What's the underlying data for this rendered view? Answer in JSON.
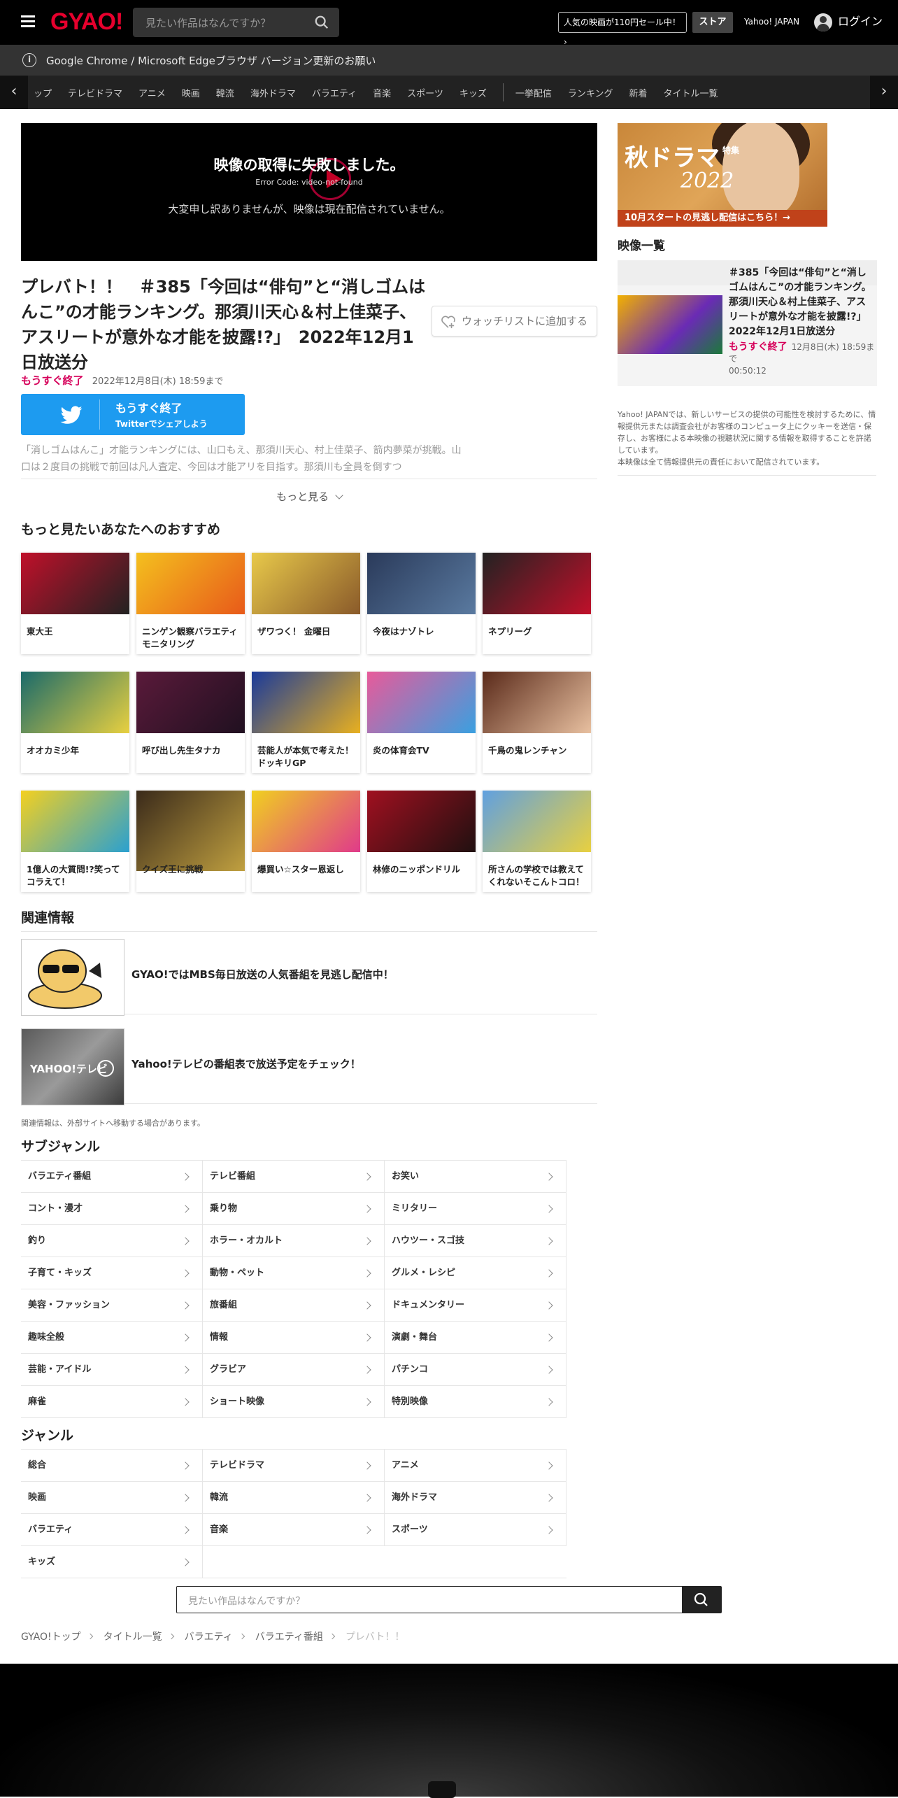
{
  "header": {
    "logo": "GYAO!",
    "search_placeholder": "見たい作品はなんですか？",
    "promo": "人気の映画が110円セール中！",
    "store": "ストア",
    "yahoo": "Yahoo! JAPAN",
    "login": "ログイン"
  },
  "notice": "Google Chrome / Microsoft Edgeブラウザ バージョン更新のお願い",
  "nav": {
    "prev": "‹",
    "next": "›",
    "items": [
      "ップ",
      "テレビドラマ",
      "アニメ",
      "映画",
      "韓流",
      "海外ドラマ",
      "バラエティ",
      "音楽",
      "スポーツ",
      "キッズ"
    ],
    "items2": [
      "一挙配信",
      "ランキング",
      "新着",
      "タイトル一覧"
    ]
  },
  "player": {
    "error_title": "映像の取得に失敗しました。",
    "error_code": "Error Code: video-not-found",
    "message": "大変申し訳ありませんが、映像は現在配信されていません。"
  },
  "episode": {
    "title": "プレバト！！　＃385「今回は“俳句”と“消しゴムはんこ”の才能ランキング。那須川天心＆村上佳菜子、アスリートが意外な才能を披露!?」　2022年12月1日放送分",
    "watchlist": "ウォッチリストに追加する",
    "status": "もうすぐ終了",
    "until": "2022年12月8日(木) 18:59まで",
    "twitter_l1": "もうすぐ終了",
    "twitter_l2": "Twitterでシェアしよう",
    "description": "「消しゴムはんこ」才能ランキングには、山口もえ、那須川天心、村上佳菜子、箭内夢菜が挑戦。山口は２度目の挑戦で前回は凡人査定、今回は才能アリを目指す。那須川も全員を倒すつ",
    "more": "もっと見る"
  },
  "recommend": {
    "heading": "もっと見たいあなたへのおすすめ",
    "items": [
      {
        "title": "東大王"
      },
      {
        "title": "ニンゲン観察バラエティ モニタリング"
      },
      {
        "title": "ザワつく！ 金曜日"
      },
      {
        "title": "今夜はナゾトレ"
      },
      {
        "title": "ネプリーグ"
      },
      {
        "title": "オオカミ少年"
      },
      {
        "title": "呼び出し先生タナカ"
      },
      {
        "title": "芸能人が本気で考えた！ドッキリGP"
      },
      {
        "title": "炎の体育会TV"
      },
      {
        "title": "千鳥の鬼レンチャン"
      },
      {
        "title": "1億人の大質問!?笑ってコラえて！"
      },
      {
        "title": "クイズ王に挑戦"
      },
      {
        "title": "爆買い☆スター恩返し"
      },
      {
        "title": "林修のニッポンドリル"
      },
      {
        "title": "所さんの学校では教えてくれないそこんトコロ！"
      }
    ]
  },
  "related": {
    "heading": "関連情報",
    "items": [
      {
        "title": "GYAO!ではMBS毎日放送の人気番組を見逃し配信中！"
      },
      {
        "title": "Yahoo!テレビの番組表で放送予定をチェック！"
      }
    ],
    "note": "関連情報は、外部サイトへ移動する場合があります。"
  },
  "subgenre": {
    "heading": "サブジャンル",
    "items": [
      "バラエティ番組",
      "テレビ番組",
      "お笑い",
      "コント・漫才",
      "乗り物",
      "ミリタリー",
      "釣り",
      "ホラー・オカルト",
      "ハウツー・スゴ技",
      "子育て・キッズ",
      "動物・ペット",
      "グルメ・レシピ",
      "美容・ファッション",
      "旅番組",
      "ドキュメンタリー",
      "趣味全般",
      "情報",
      "演劇・舞台",
      "芸能・アイドル",
      "グラビア",
      "パチンコ",
      "麻雀",
      "ショート映像",
      "特別映像"
    ]
  },
  "genre": {
    "heading": "ジャンル",
    "items": [
      "総合",
      "テレビドラマ",
      "アニメ",
      "映画",
      "韓流",
      "海外ドラマ",
      "バラエティ",
      "音楽",
      "スポーツ",
      "キッズ"
    ]
  },
  "bottom_search": "見たい作品はなんですか？",
  "breadcrumb": [
    "GYAO!トップ",
    "タイトル一覧",
    "バラエティ",
    "バラエティ番組",
    "プレバト！！"
  ],
  "sidebar": {
    "banner_t1": "秋ドラマ",
    "banner_t2": "2022",
    "banner_small": "特集",
    "banner_bar": "10月スタートの見逃し配信はこちら！→",
    "heading": "映像一覧",
    "item_title": "＃385「今回は“俳句”と“消しゴムはんこ”の才能ランキング。那須川天心＆村上佳菜子、アスリートが意外な才能を披露!?」　2022年12月1日放送分",
    "item_status": "もうすぐ終了",
    "item_until": "12月8日(木) 18:59まで",
    "item_duration": "00:50:12",
    "note": "Yahoo! JAPANでは、新しいサービスの提供の可能性を検討するために、情報提供元または調査会社がお客様のコンピュータ上にクッキーを送信・保存し、お客様による本映像の視聴状況に関する情報を取得することを許諾しています。\n本映像は全て情報提供元の責任において配信されています。"
  },
  "colors": {
    "brand": "#e6002d",
    "accent": "#d6005a",
    "twitter": "#1d9bf0"
  }
}
